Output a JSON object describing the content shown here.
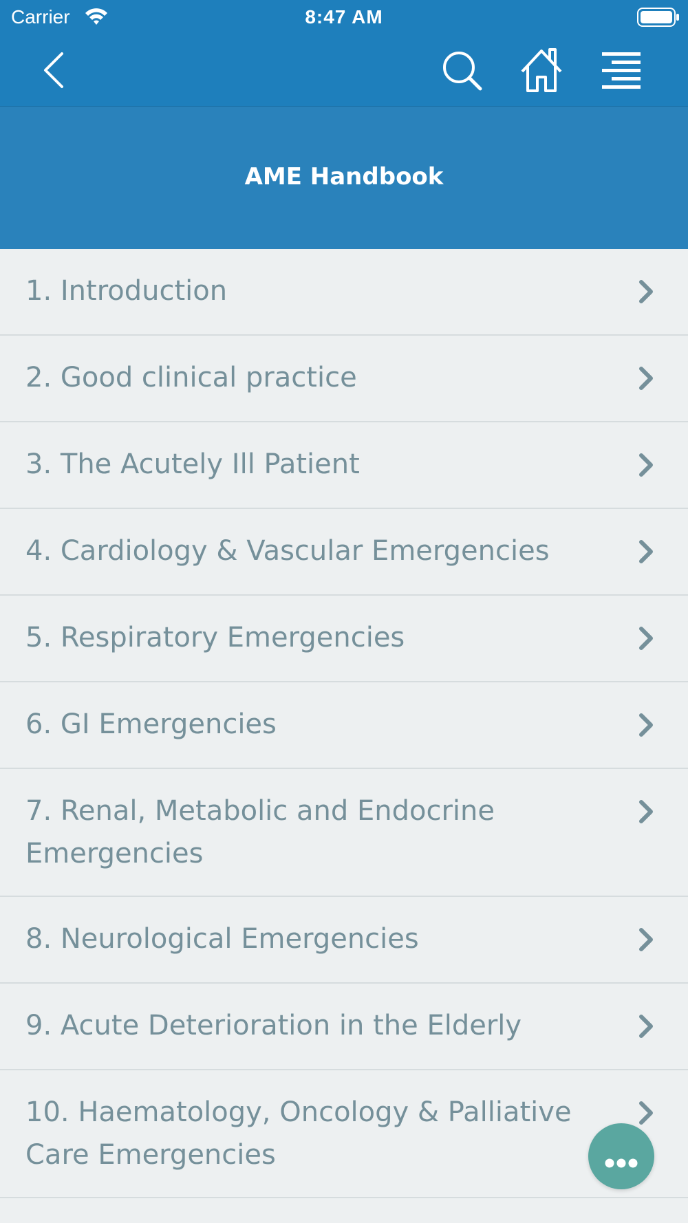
{
  "status_bar": {
    "carrier": "Carrier",
    "time": "8:47 AM",
    "wifi_icon": "wifi-icon",
    "battery_icon": "battery-icon"
  },
  "nav_bar": {
    "back_icon": "chevron-left-icon",
    "search_icon": "search-icon",
    "home_icon": "home-icon",
    "menu_icon": "menu-icon"
  },
  "header": {
    "title": "AME Handbook"
  },
  "chapters": [
    {
      "label": "1. Introduction"
    },
    {
      "label": "2. Good clinical practice"
    },
    {
      "label": "3. The Acutely Ill Patient"
    },
    {
      "label": "4. Cardiology & Vascular Emergencies"
    },
    {
      "label": "5. Respiratory Emergencies"
    },
    {
      "label": "6. GI Emergencies"
    },
    {
      "label": "7. Renal, Metabolic and Endocrine Emergencies"
    },
    {
      "label": "8. Neurological Emergencies"
    },
    {
      "label": "9. Acute Deterioration in the Elderly"
    },
    {
      "label": "10. Haematology, Oncology & Palliative Care Emergencies"
    }
  ],
  "fab": {
    "icon": "more-icon"
  },
  "colors": {
    "primary_blue": "#1e7fbc",
    "title_band_blue": "#2a82bb",
    "list_background": "#edf0f1",
    "list_text": "#75909a",
    "fab_teal": "#5aa7a0"
  }
}
